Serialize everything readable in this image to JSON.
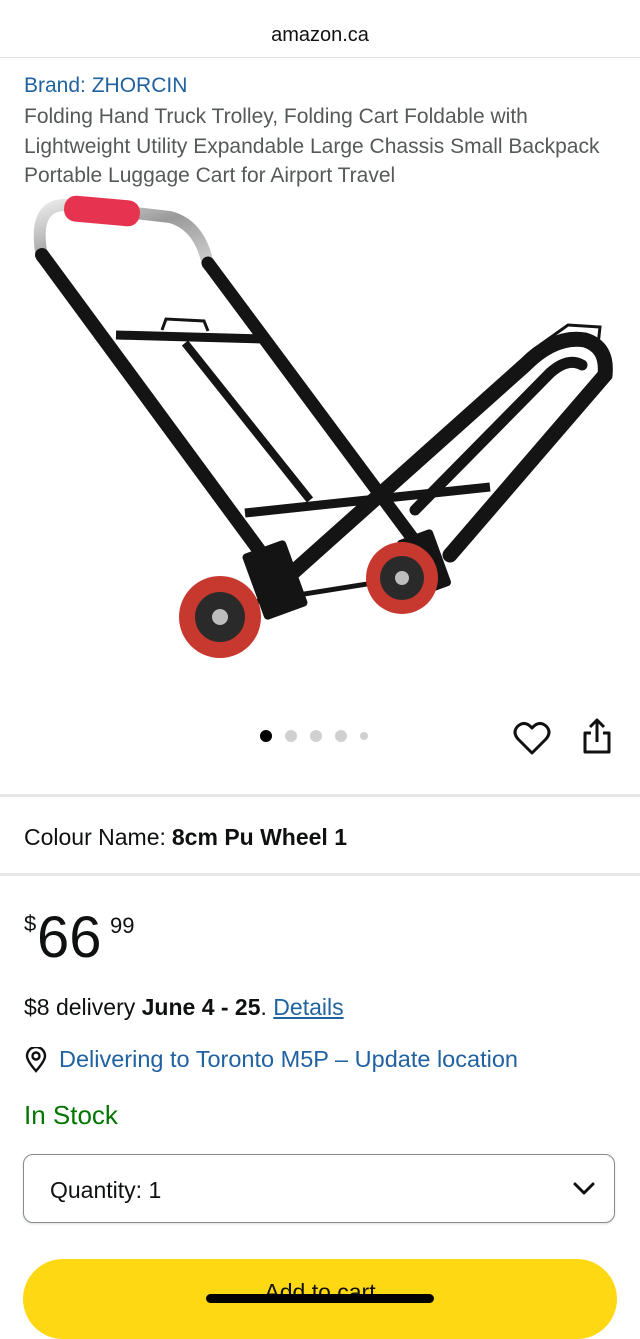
{
  "browser": {
    "url": "amazon.ca"
  },
  "product": {
    "brand": "Brand: ZHORCIN",
    "title": "Folding Hand Truck Trolley, Folding Cart Foldable with Lightweight Utility Expandable Large Chassis Small Backpack Portable Luggage Cart for Airport Travel",
    "image_count": 5,
    "active_image": 1
  },
  "variation": {
    "label": "Colour Name:",
    "value": "8cm Pu Wheel 1"
  },
  "price": {
    "symbol": "$",
    "whole": "66",
    "fraction": "99"
  },
  "delivery": {
    "prefix": "$8 delivery ",
    "dates": "June 4 - 25",
    "period": ".",
    "details_link": "Details"
  },
  "location": {
    "text": "Delivering to Toronto M5P – Update location",
    "icon": "location-pin-icon"
  },
  "stock": {
    "status": "In Stock"
  },
  "quantity": {
    "label": "Quantity:",
    "value": "1"
  },
  "cart": {
    "button_label": "Add to cart"
  },
  "icons": {
    "wishlist": "heart-icon",
    "share": "share-icon",
    "dropdown": "chevron-down-icon"
  },
  "colors": {
    "link": "#2162a1",
    "in_stock": "#007600",
    "add_to_cart": "#ffd814",
    "title": "#565959"
  }
}
